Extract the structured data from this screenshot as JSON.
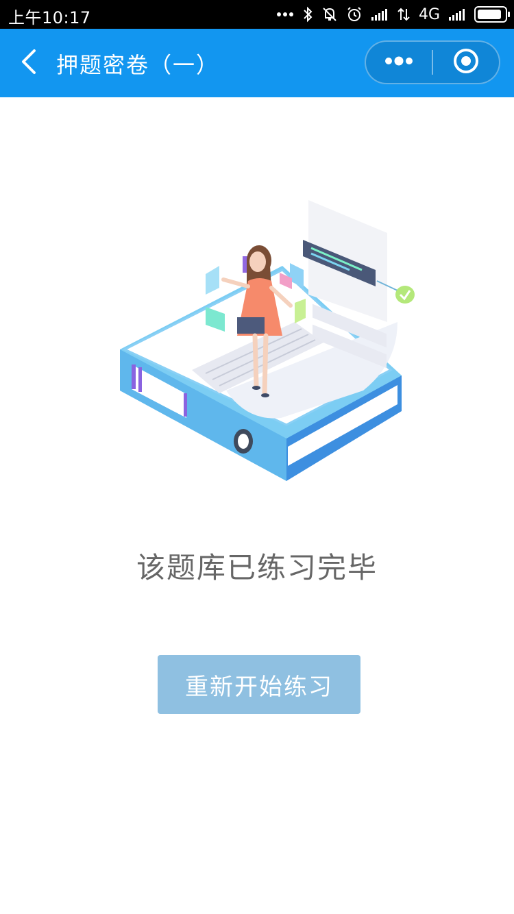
{
  "status_bar": {
    "time": "上午10:17",
    "network": "4G",
    "battery_level": 0.9
  },
  "nav": {
    "title": "押题密卷（一）",
    "back_icon": "chevron-left-icon",
    "more_icon": "more-dots-icon",
    "close_icon": "target-circle-icon",
    "color": "#1296f0"
  },
  "main": {
    "illustration": "completed-exam-illustration",
    "message": "该题库已练习完毕",
    "restart_label": "重新开始练习",
    "button_color": "#8fc0e1"
  }
}
